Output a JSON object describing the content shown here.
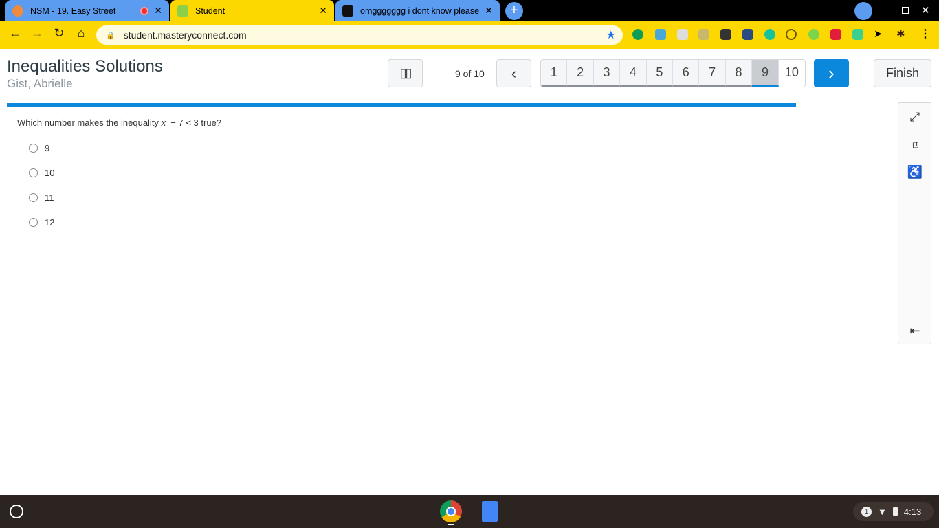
{
  "browser": {
    "tabs": [
      {
        "title": "NSM - 19. Easy Street",
        "active": false
      },
      {
        "title": "Student",
        "active": true
      },
      {
        "title": "omggggggg i dont know please",
        "active": false
      }
    ],
    "url": "student.masteryconnect.com",
    "colors": {
      "tab_inactive": "#5b9cf0",
      "tab_active": "#fdd800",
      "toolbar": "#fdd800"
    }
  },
  "assessment": {
    "title": "Inequalities Solutions",
    "student": "Gist, Abrielle",
    "position": "9 of 10",
    "pages": [
      "1",
      "2",
      "3",
      "4",
      "5",
      "6",
      "7",
      "8",
      "9",
      "10"
    ],
    "current_page": 9,
    "finish_label": "Finish",
    "progress_percent": 90,
    "accent": "#0b88dc"
  },
  "question": {
    "text_before": "Which number makes the inequality",
    "variable": "x",
    "text_after": "− 7 < 3 true?",
    "options": [
      "9",
      "10",
      "11",
      "12"
    ]
  },
  "tray": {
    "notification_count": "1",
    "time": "4:13"
  }
}
